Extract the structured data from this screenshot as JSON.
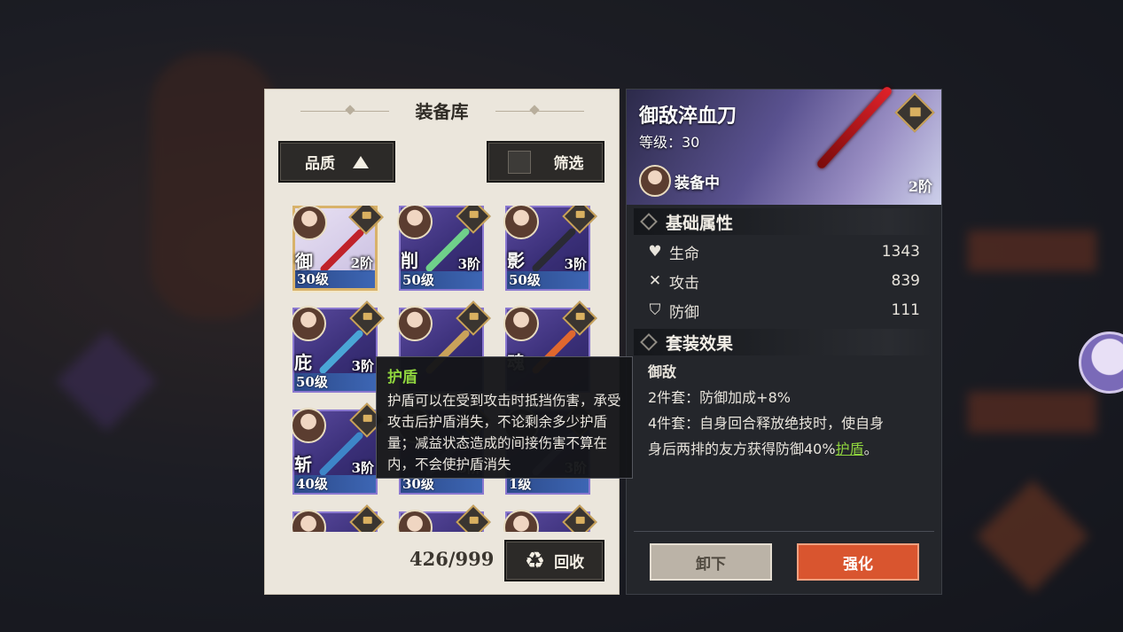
{
  "library": {
    "title": "装备库",
    "sort_label": "品质",
    "filter_label": "筛选",
    "count": "426/999",
    "recycle_label": "回收",
    "items": [
      {
        "name": "御",
        "level": "30级",
        "tier": "2阶",
        "weapon_color": "#c0222a",
        "selected": true
      },
      {
        "name": "削",
        "level": "50级",
        "tier": "3阶",
        "weapon_color": "#6fd08a",
        "selected": false
      },
      {
        "name": "影",
        "level": "50级",
        "tier": "3阶",
        "weapon_color": "#2a2a34",
        "selected": false
      },
      {
        "name": "庇",
        "level": "50级",
        "tier": "3阶",
        "weapon_color": "#4aa6d6",
        "selected": false
      },
      {
        "name": "",
        "level": "",
        "tier": "",
        "weapon_color": "#c9a25a",
        "selected": false
      },
      {
        "name": "魂",
        "level": "",
        "tier": "",
        "weapon_color": "#e0682e",
        "selected": false
      },
      {
        "name": "斩",
        "level": "40级",
        "tier": "3阶",
        "weapon_color": "#3d86c8",
        "selected": false
      },
      {
        "name": "",
        "level": "30级",
        "tier": "3阶",
        "weapon_color": "#6a6ab8",
        "selected": false
      },
      {
        "name": "",
        "level": "1级",
        "tier": "3阶",
        "weapon_color": "#8a8ac8",
        "selected": false
      },
      {
        "name": "",
        "level": "",
        "tier": "",
        "weapon_color": "#8a8ac8",
        "selected": false
      },
      {
        "name": "",
        "level": "",
        "tier": "",
        "weapon_color": "#8a8ac8",
        "selected": false
      },
      {
        "name": "",
        "level": "",
        "tier": "",
        "weapon_color": "#8a8ac8",
        "selected": false
      }
    ]
  },
  "detail": {
    "title": "御敌淬血刀",
    "level": "等级：30",
    "equipped_label": "装备中",
    "tier": "2阶",
    "base_section": "基础属性",
    "stats": [
      {
        "icon": "heart-icon",
        "glyph": "♥",
        "label": "生命",
        "value": "1343"
      },
      {
        "icon": "swords-icon",
        "glyph": "✕",
        "label": "攻击",
        "value": "839"
      },
      {
        "icon": "shield-icon",
        "glyph": "⛉",
        "label": "防御",
        "value": "111"
      }
    ],
    "set_section": "套装效果",
    "set_name": "御敌",
    "set_2": "2件套：防御加成+8%",
    "set_4_line1": "4件套：自身回合释放绝技时，使自身",
    "set_4_line2_a": "身后两排的友方获得防御40%",
    "set_4_keyword": "护盾",
    "set_4_line2_b": "。",
    "unequip_label": "卸下",
    "enhance_label": "强化"
  },
  "tooltip": {
    "title": "护盾",
    "body": "护盾可以在受到攻击时抵挡伤害，承受攻击后护盾消失，不论剩余多少护盾量；减益状态造成的间接伤害不算在内，不会使护盾消失"
  },
  "colors": {
    "accent_green": "#8fd43e",
    "enhance_orange": "#d9552f",
    "card_purple": "#4a3d8e",
    "gold": "#c9a25a"
  }
}
